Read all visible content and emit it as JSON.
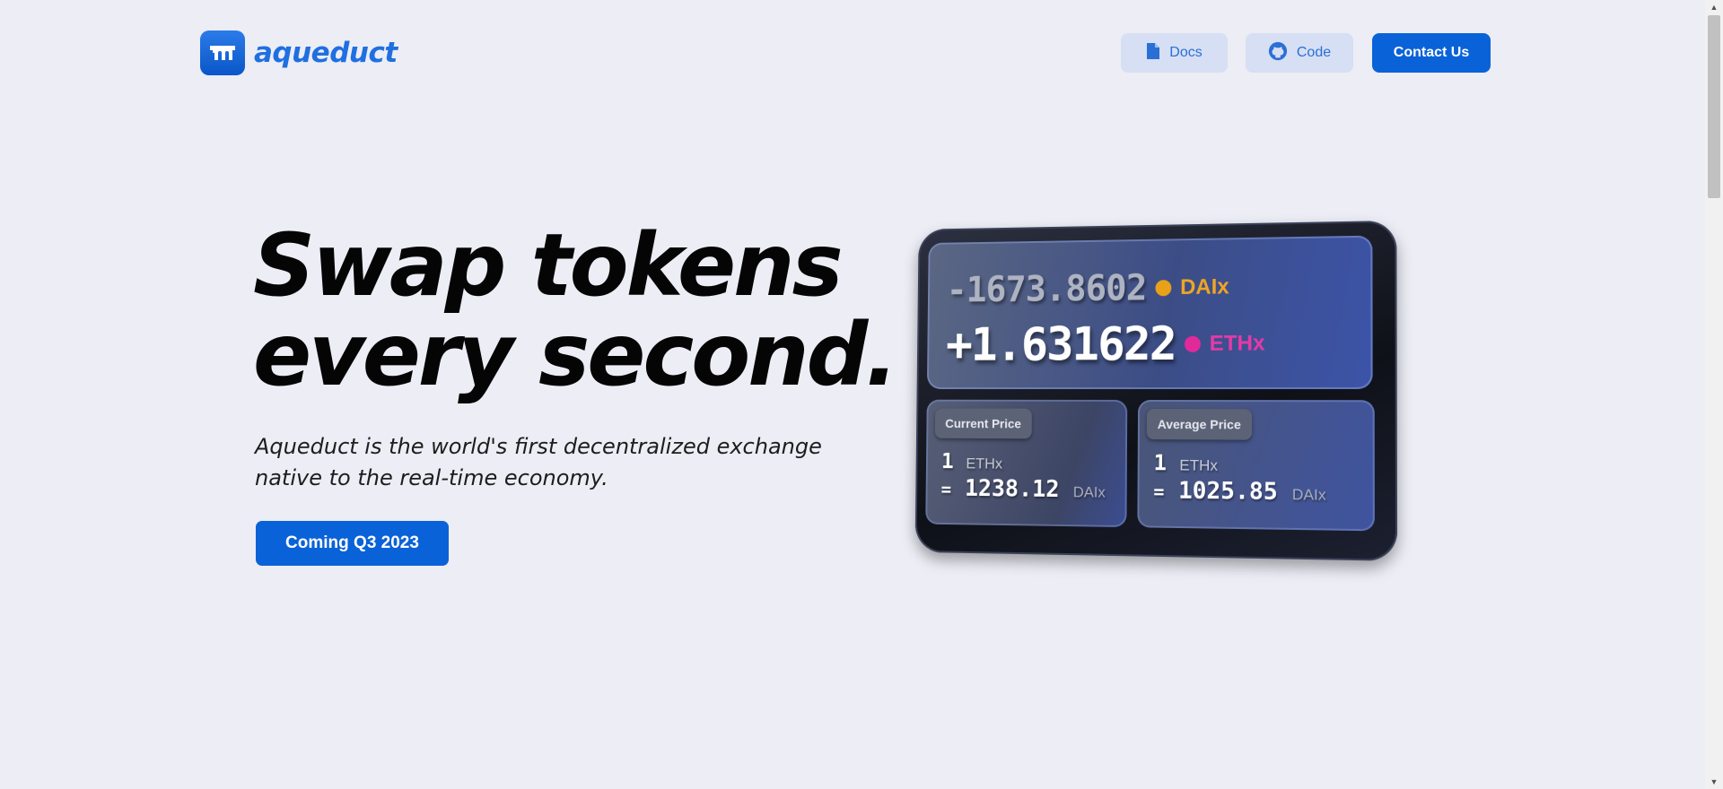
{
  "brand": {
    "name": "aqueduct",
    "accent": "#0a62d8"
  },
  "nav": {
    "docs_label": "Docs",
    "code_label": "Code",
    "contact_label": "Contact Us"
  },
  "hero": {
    "headline_line1": "Swap tokens",
    "headline_line2": "every second.",
    "subtext_line1": "Aqueduct is the world's first decentralized exchange",
    "subtext_line2": "native to the real-time economy.",
    "cta_label": "Coming Q3 2023"
  },
  "device": {
    "balance_out": "-1673.8602",
    "balance_out_token": "DAIx",
    "balance_out_color": "#e9a11a",
    "balance_in": "+1.631622",
    "balance_in_token": "ETHx",
    "balance_in_color": "#e02a9a",
    "current": {
      "label": "Current Price",
      "base_amount": "1",
      "base_token": "ETHx",
      "eq": "=",
      "quote_amount": "1238.12",
      "quote_token": "DAIx"
    },
    "average": {
      "label": "Average Price",
      "base_amount": "1",
      "base_token": "ETHx",
      "eq": "=",
      "quote_amount": "1025.85",
      "quote_token": "DAIx"
    }
  },
  "icons": {
    "docs": "document-icon",
    "code": "github-icon",
    "logo": "aqueduct-logo-icon"
  }
}
